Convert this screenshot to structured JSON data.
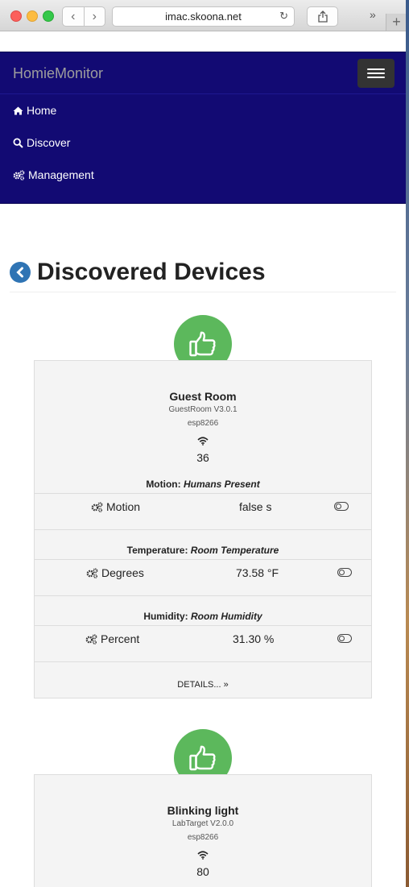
{
  "browser": {
    "url": "imac.skoona.net"
  },
  "navbar": {
    "brand": "HomieMonitor",
    "items": [
      {
        "label": "Home",
        "icon": "home-icon"
      },
      {
        "label": "Discover",
        "icon": "search-icon"
      },
      {
        "label": "Management",
        "icon": "gears-icon"
      }
    ]
  },
  "page": {
    "title": "Discovered Devices"
  },
  "devices": [
    {
      "name": "Guest Room",
      "firmware": "GuestRoom V3.0.1",
      "platform": "esp8266",
      "signal": "36",
      "nodes": [
        {
          "type": "Motion",
          "name": "Humans Present",
          "property": "Motion",
          "value": "false s"
        },
        {
          "type": "Temperature",
          "name": "Room Temperature",
          "property": "Degrees",
          "value": "73.58 °F"
        },
        {
          "type": "Humidity",
          "name": "Room Humidity",
          "property": "Percent",
          "value": "31.30 %"
        }
      ],
      "details_label": "DETAILS..."
    },
    {
      "name": "Blinking light",
      "firmware": "LabTarget V2.0.0",
      "platform": "esp8266",
      "signal": "80"
    }
  ],
  "colors": {
    "navbar": "#120a73",
    "badge": "#5cb85c",
    "back_button": "#2f74b4"
  }
}
